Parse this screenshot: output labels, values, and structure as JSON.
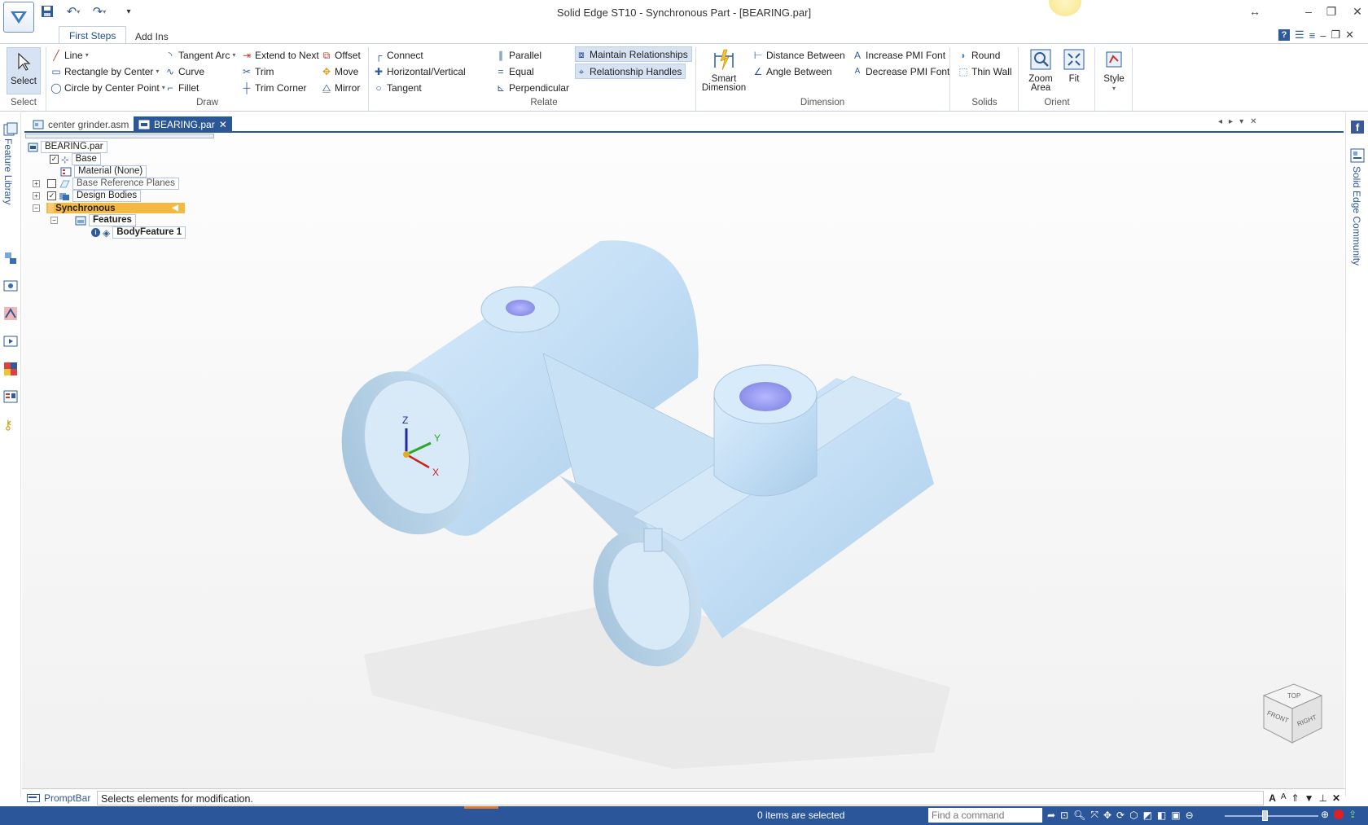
{
  "window": {
    "title": "Solid Edge ST10 - Synchronous Part - [BEARING.par]",
    "controls": [
      "↔",
      "–",
      "❐",
      "✕"
    ]
  },
  "ribbon_tabs": [
    {
      "label": "First Steps",
      "active": true
    },
    {
      "label": "Add Ins",
      "active": false
    }
  ],
  "ribbon": {
    "select": {
      "button": "Select",
      "group": "Select"
    },
    "draw": {
      "group": "Draw",
      "items": [
        "Line",
        "Rectangle by Center",
        "Circle by Center Point",
        "Tangent Arc",
        "Curve",
        "Fillet",
        "Extend to Next",
        "Trim",
        "Trim Corner",
        "Offset",
        "Move",
        "Mirror"
      ]
    },
    "relate": {
      "group": "Relate",
      "items": [
        "Connect",
        "Horizontal/Vertical",
        "Tangent",
        "Parallel",
        "Equal",
        "Perpendicular",
        "Maintain Relationships",
        "Relationship Handles"
      ]
    },
    "dimension": {
      "group": "Dimension",
      "smart": "Smart Dimension",
      "items": [
        "Distance Between",
        "Angle Between",
        "Increase PMI Font",
        "Decrease PMI Font"
      ]
    },
    "solids": {
      "group": "Solids",
      "items": [
        "Round",
        "Thin Wall"
      ]
    },
    "orient": {
      "group": "Orient",
      "zoom_area": "Zoom Area",
      "fit": "Fit"
    },
    "style": {
      "label": "Style"
    }
  },
  "doc_tabs": [
    {
      "label": "center grinder.asm",
      "active": false
    },
    {
      "label": "BEARING.par",
      "active": true
    }
  ],
  "left_panel": {
    "label": "Feature Library"
  },
  "right_panel": {
    "label": "Solid Edge Community"
  },
  "tree": {
    "root": "BEARING.par",
    "items": [
      "Base",
      "Material (None)",
      "Base Reference Planes",
      "Design Bodies",
      "Synchronous",
      "Features",
      "BodyFeature 1"
    ]
  },
  "triad": {
    "x": "X",
    "y": "Y",
    "z": "Z"
  },
  "view_cube": {
    "top": "TOP",
    "front": "FRONT",
    "right": "RIGHT"
  },
  "promptbar": {
    "label": "PromptBar",
    "text": "Selects elements for modification."
  },
  "status": {
    "selection": "0 items are selected",
    "command_placeholder": "Find a command"
  },
  "colors": {
    "accent": "#2b579a",
    "part": "#c9e2f7",
    "synchronous": "#f5b942"
  }
}
